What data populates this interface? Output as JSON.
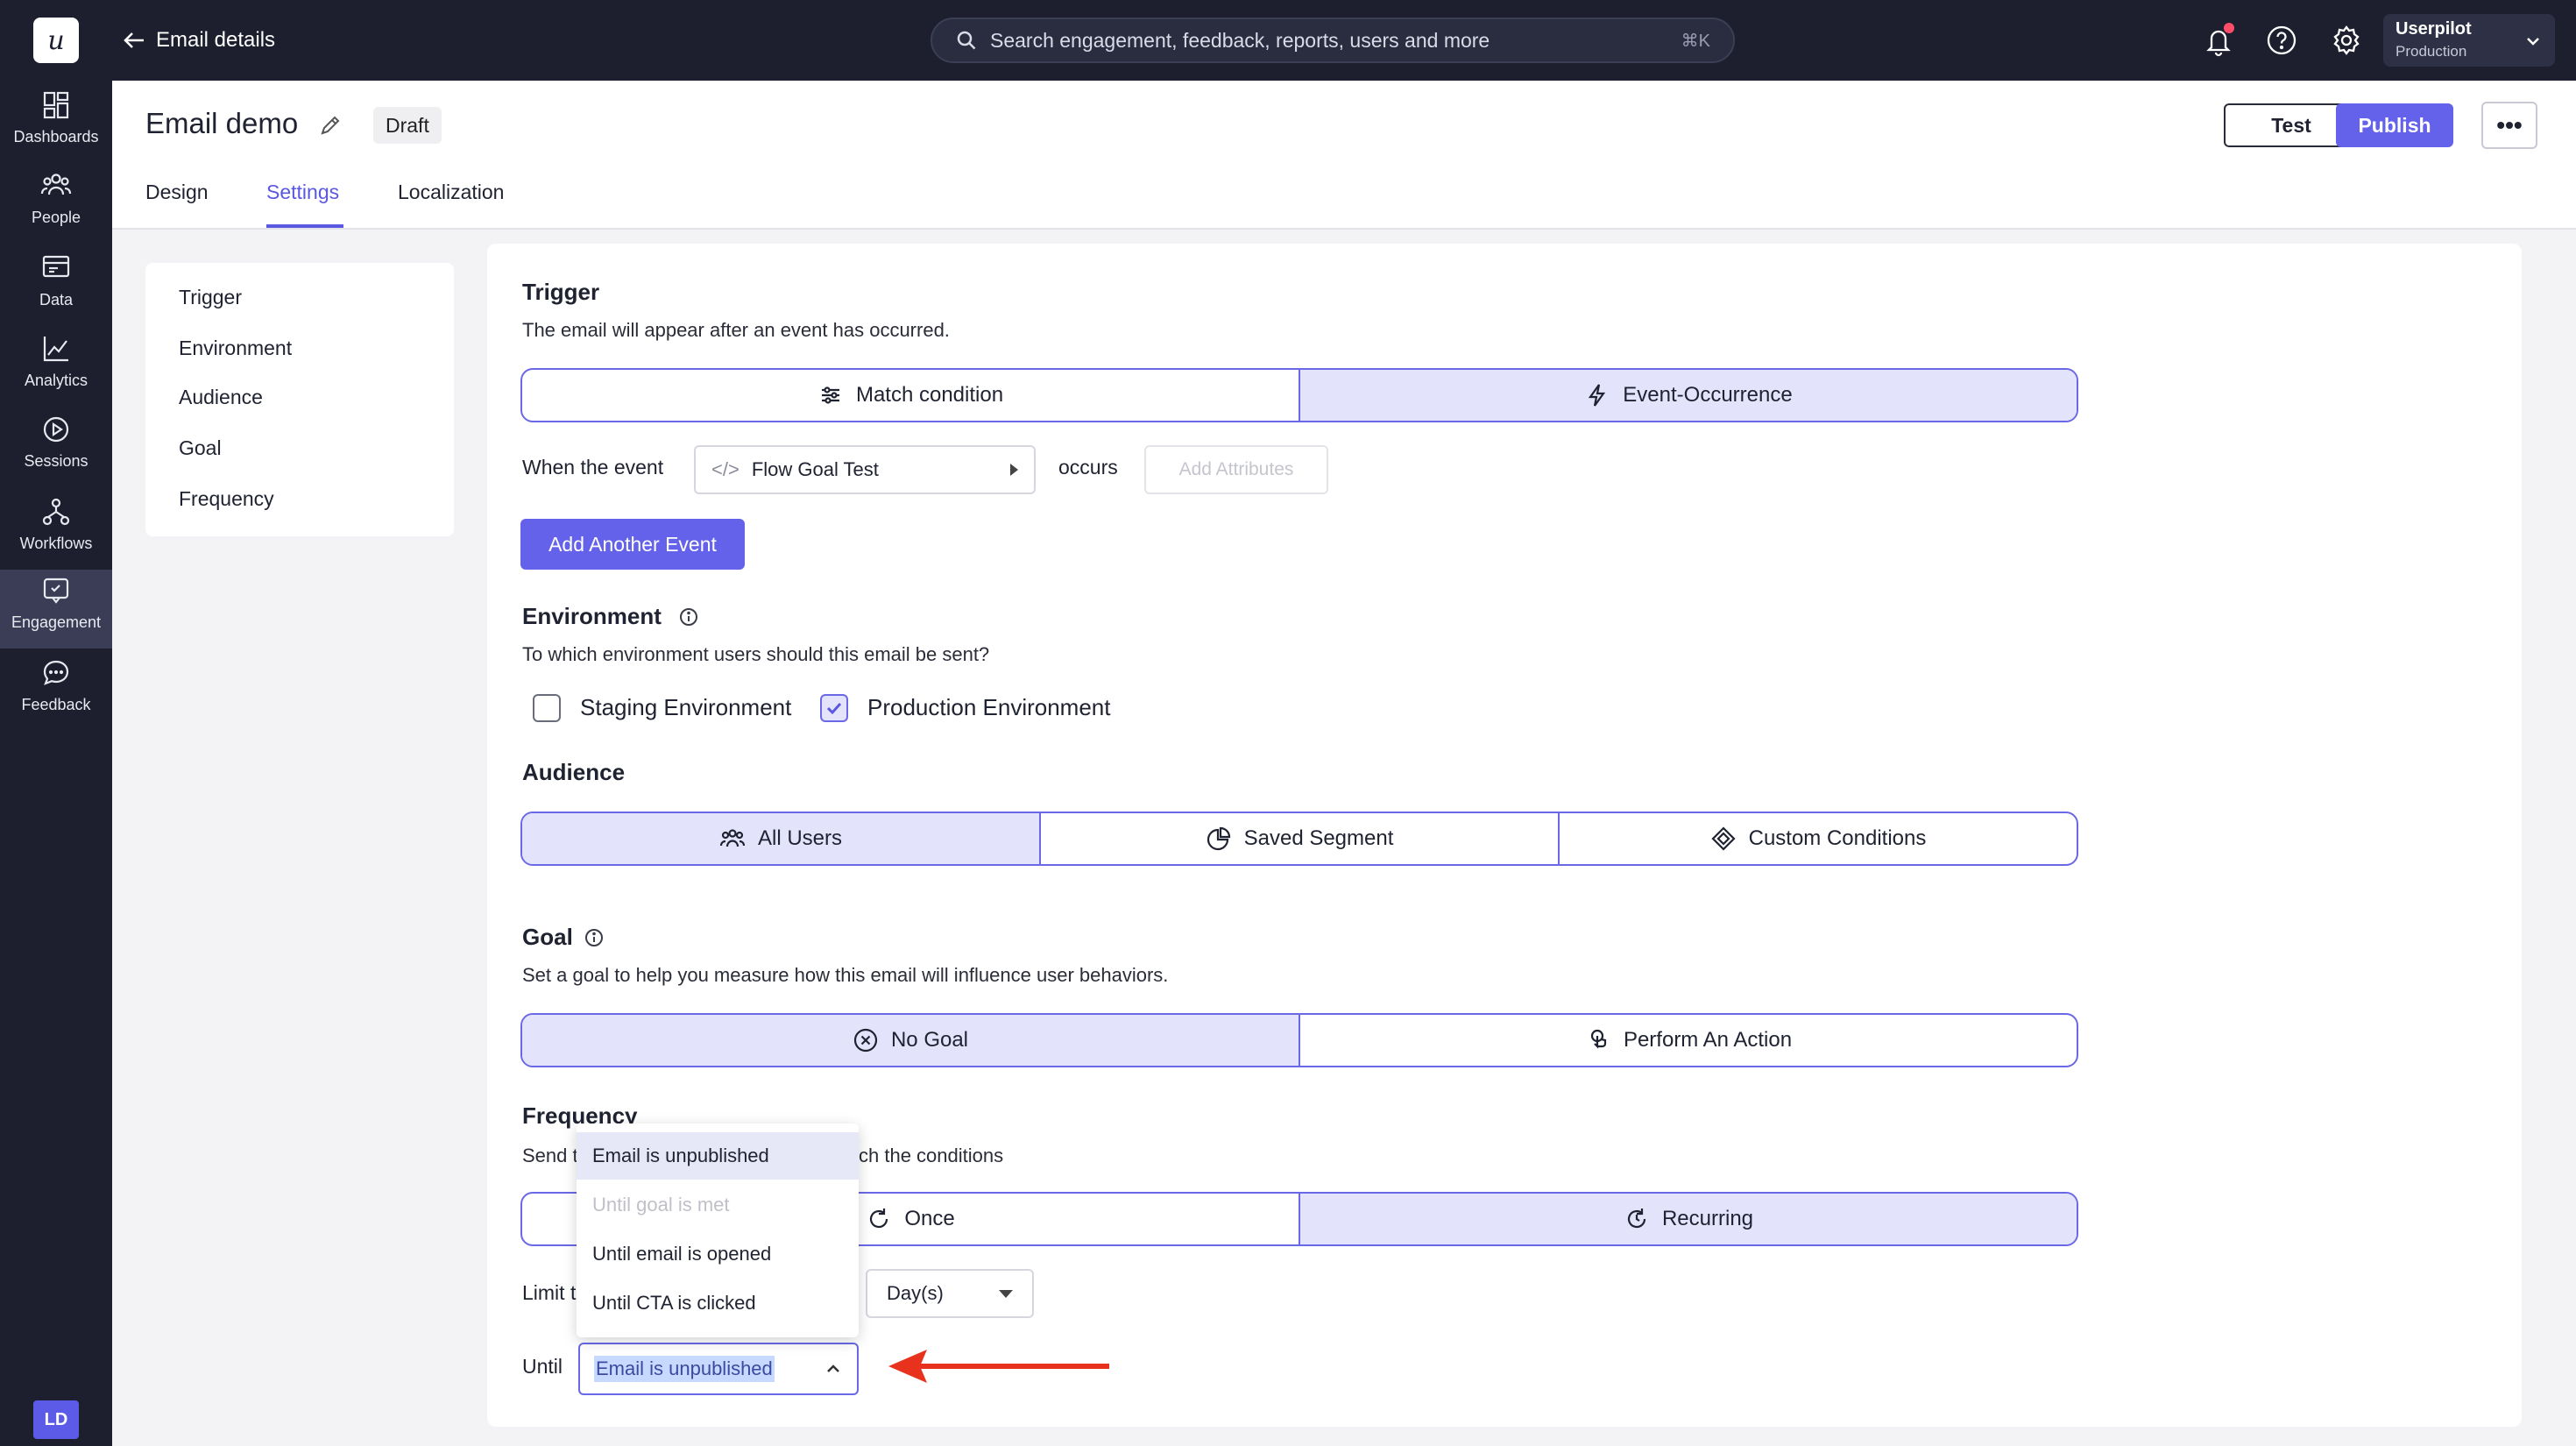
{
  "leftnav": {
    "logo": "u",
    "items": [
      {
        "label": "Dashboards",
        "icon": "dashboard-icon"
      },
      {
        "label": "People",
        "icon": "people-icon"
      },
      {
        "label": "Data",
        "icon": "data-icon"
      },
      {
        "label": "Analytics",
        "icon": "analytics-icon"
      },
      {
        "label": "Sessions",
        "icon": "play-icon"
      },
      {
        "label": "Workflows",
        "icon": "workflow-icon"
      },
      {
        "label": "Engagement",
        "icon": "engagement-icon"
      },
      {
        "label": "Feedback",
        "icon": "chat-icon"
      }
    ],
    "avatar": "LD"
  },
  "topbar": {
    "back_label": "Email details",
    "search_placeholder": "Search engagement, feedback, reports, users and more",
    "search_shortcut": "⌘K",
    "account_name": "Userpilot",
    "account_env": "Production"
  },
  "header": {
    "title": "Email demo",
    "status": "Draft",
    "test_label": "Test",
    "publish_label": "Publish",
    "more_label": "•••",
    "tabs": [
      "Design",
      "Settings",
      "Localization"
    ]
  },
  "sidenav": [
    "Trigger",
    "Environment",
    "Audience",
    "Goal",
    "Frequency"
  ],
  "trigger": {
    "title": "Trigger",
    "desc": "The email will appear after an event has occurred.",
    "options": [
      "Match condition",
      "Event-Occurrence"
    ],
    "selected": "Event-Occurrence",
    "when_label": "When the event",
    "event_code": "</>",
    "event_value": "Flow Goal Test",
    "occurs_label": "occurs",
    "add_attributes": "Add Attributes",
    "add_event": "Add Another Event"
  },
  "environment": {
    "title": "Environment",
    "desc": "To which environment users should this email be sent?",
    "staging": "Staging Environment",
    "production": "Production Environment"
  },
  "audience": {
    "title": "Audience",
    "options": [
      "All Users",
      "Saved Segment",
      "Custom Conditions"
    ],
    "selected": "All Users"
  },
  "goal": {
    "title": "Goal",
    "desc": "Set a goal to help you measure how this email will influence user behaviors.",
    "options": [
      "No Goal",
      "Perform An Action"
    ],
    "selected": "No Goal"
  },
  "frequency": {
    "title": "Frequency",
    "desc_start": "Send t",
    "desc_end": "ch the conditions",
    "options": [
      "Once",
      "Recurring"
    ],
    "selected": "Recurring",
    "limit_label": "Limit t",
    "period": "Day(s)",
    "until_label": "Until",
    "until_value": "Email is unpublished",
    "dropdown": [
      "Email is unpublished",
      "Until goal is met",
      "Until email is opened",
      "Until CTA is clicked"
    ]
  },
  "colors": {
    "accent": "#6462ea",
    "nav_bg": "#1d1f2e",
    "selected_bg": "#e3e3fb",
    "annotation": "#e8321e"
  }
}
